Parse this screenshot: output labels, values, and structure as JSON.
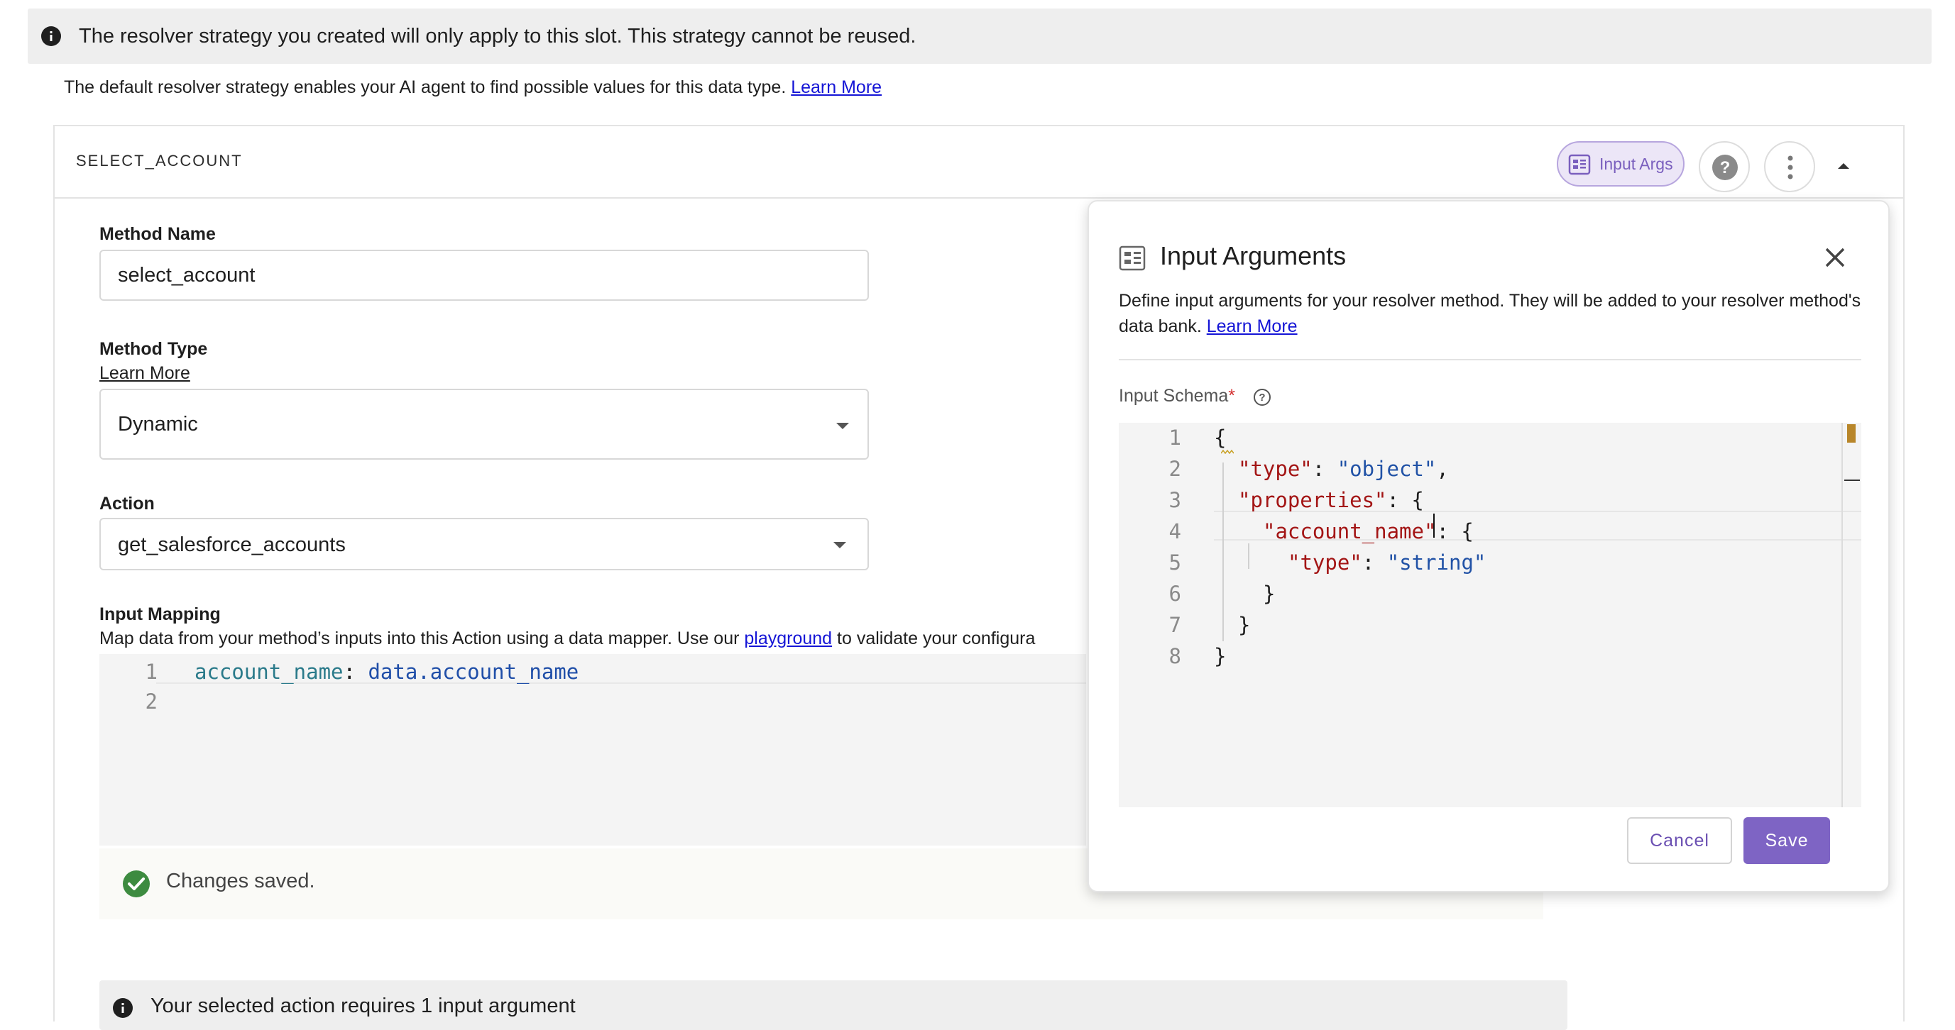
{
  "banner": {
    "text": "The resolver strategy you created will only apply to this slot. This strategy cannot be reused."
  },
  "subtext": {
    "text": "The default resolver strategy enables your AI agent to find possible values for this data type.",
    "link": "Learn More"
  },
  "card": {
    "slot_name": "SELECT_ACCOUNT",
    "input_args_button": "Input Args"
  },
  "form": {
    "method_name_label": "Method Name",
    "method_name_value": "select_account",
    "method_type_label": "Method Type",
    "method_type_link": "Learn More",
    "method_type_value": "Dynamic",
    "action_label": "Action",
    "action_value": "get_salesforce_accounts",
    "input_mapping_label": "Input Mapping",
    "input_mapping_desc_pre": "Map data from your method’s inputs into this Action using a data mapper. Use our ",
    "input_mapping_desc_link": "playground",
    "input_mapping_desc_post": " to validate your configura",
    "mapping_code": {
      "line_numbers": [
        "1",
        "2"
      ],
      "key": "account_name",
      "colon": ": ",
      "value": "data.account_name"
    }
  },
  "status": {
    "saved_text": "Changes saved.",
    "notice_text": "Your selected action requires 1 input argument"
  },
  "popover": {
    "title": "Input Arguments",
    "desc": "Define input arguments for your resolver method. They will be added to your resolver method's data bank.",
    "desc_link": "Learn More",
    "schema_label": "Input Schema",
    "required_mark": "*",
    "line_numbers": [
      "1",
      "2",
      "3",
      "4",
      "5",
      "6",
      "7",
      "8"
    ],
    "json": {
      "l1": "{",
      "l2_key": "\"type\"",
      "l2_val": "\"object\"",
      "l3_key": "\"properties\"",
      "l4_key_a": "\"account_name",
      "l4_key_b": "\"",
      "l5_key": "\"type\"",
      "l5_val": "\"string\"",
      "l6": "}",
      "l7": "}",
      "l8": "}"
    },
    "cancel_label": "Cancel",
    "save_label": "Save"
  },
  "colors": {
    "accent": "#7e64c4",
    "success": "#3d8b40",
    "banner_bg": "#eeeeee"
  },
  "icons": [
    "info-icon",
    "input-args-icon",
    "help-icon",
    "more-vert-icon",
    "chevron-up-icon",
    "close-icon",
    "help-outline-icon",
    "check-circle-icon"
  ]
}
